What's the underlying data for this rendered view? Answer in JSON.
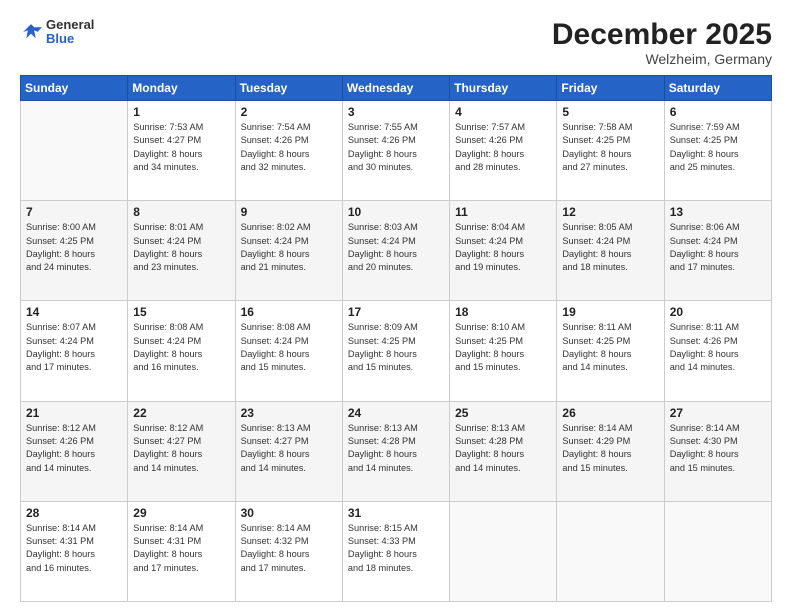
{
  "header": {
    "logo_general": "General",
    "logo_blue": "Blue",
    "month": "December 2025",
    "location": "Welzheim, Germany"
  },
  "weekdays": [
    "Sunday",
    "Monday",
    "Tuesday",
    "Wednesday",
    "Thursday",
    "Friday",
    "Saturday"
  ],
  "weeks": [
    [
      {
        "day": "",
        "info": ""
      },
      {
        "day": "1",
        "info": "Sunrise: 7:53 AM\nSunset: 4:27 PM\nDaylight: 8 hours\nand 34 minutes."
      },
      {
        "day": "2",
        "info": "Sunrise: 7:54 AM\nSunset: 4:26 PM\nDaylight: 8 hours\nand 32 minutes."
      },
      {
        "day": "3",
        "info": "Sunrise: 7:55 AM\nSunset: 4:26 PM\nDaylight: 8 hours\nand 30 minutes."
      },
      {
        "day": "4",
        "info": "Sunrise: 7:57 AM\nSunset: 4:26 PM\nDaylight: 8 hours\nand 28 minutes."
      },
      {
        "day": "5",
        "info": "Sunrise: 7:58 AM\nSunset: 4:25 PM\nDaylight: 8 hours\nand 27 minutes."
      },
      {
        "day": "6",
        "info": "Sunrise: 7:59 AM\nSunset: 4:25 PM\nDaylight: 8 hours\nand 25 minutes."
      }
    ],
    [
      {
        "day": "7",
        "info": "Sunrise: 8:00 AM\nSunset: 4:25 PM\nDaylight: 8 hours\nand 24 minutes."
      },
      {
        "day": "8",
        "info": "Sunrise: 8:01 AM\nSunset: 4:24 PM\nDaylight: 8 hours\nand 23 minutes."
      },
      {
        "day": "9",
        "info": "Sunrise: 8:02 AM\nSunset: 4:24 PM\nDaylight: 8 hours\nand 21 minutes."
      },
      {
        "day": "10",
        "info": "Sunrise: 8:03 AM\nSunset: 4:24 PM\nDaylight: 8 hours\nand 20 minutes."
      },
      {
        "day": "11",
        "info": "Sunrise: 8:04 AM\nSunset: 4:24 PM\nDaylight: 8 hours\nand 19 minutes."
      },
      {
        "day": "12",
        "info": "Sunrise: 8:05 AM\nSunset: 4:24 PM\nDaylight: 8 hours\nand 18 minutes."
      },
      {
        "day": "13",
        "info": "Sunrise: 8:06 AM\nSunset: 4:24 PM\nDaylight: 8 hours\nand 17 minutes."
      }
    ],
    [
      {
        "day": "14",
        "info": "Sunrise: 8:07 AM\nSunset: 4:24 PM\nDaylight: 8 hours\nand 17 minutes."
      },
      {
        "day": "15",
        "info": "Sunrise: 8:08 AM\nSunset: 4:24 PM\nDaylight: 8 hours\nand 16 minutes."
      },
      {
        "day": "16",
        "info": "Sunrise: 8:08 AM\nSunset: 4:24 PM\nDaylight: 8 hours\nand 15 minutes."
      },
      {
        "day": "17",
        "info": "Sunrise: 8:09 AM\nSunset: 4:25 PM\nDaylight: 8 hours\nand 15 minutes."
      },
      {
        "day": "18",
        "info": "Sunrise: 8:10 AM\nSunset: 4:25 PM\nDaylight: 8 hours\nand 15 minutes."
      },
      {
        "day": "19",
        "info": "Sunrise: 8:11 AM\nSunset: 4:25 PM\nDaylight: 8 hours\nand 14 minutes."
      },
      {
        "day": "20",
        "info": "Sunrise: 8:11 AM\nSunset: 4:26 PM\nDaylight: 8 hours\nand 14 minutes."
      }
    ],
    [
      {
        "day": "21",
        "info": "Sunrise: 8:12 AM\nSunset: 4:26 PM\nDaylight: 8 hours\nand 14 minutes."
      },
      {
        "day": "22",
        "info": "Sunrise: 8:12 AM\nSunset: 4:27 PM\nDaylight: 8 hours\nand 14 minutes."
      },
      {
        "day": "23",
        "info": "Sunrise: 8:13 AM\nSunset: 4:27 PM\nDaylight: 8 hours\nand 14 minutes."
      },
      {
        "day": "24",
        "info": "Sunrise: 8:13 AM\nSunset: 4:28 PM\nDaylight: 8 hours\nand 14 minutes."
      },
      {
        "day": "25",
        "info": "Sunrise: 8:13 AM\nSunset: 4:28 PM\nDaylight: 8 hours\nand 14 minutes."
      },
      {
        "day": "26",
        "info": "Sunrise: 8:14 AM\nSunset: 4:29 PM\nDaylight: 8 hours\nand 15 minutes."
      },
      {
        "day": "27",
        "info": "Sunrise: 8:14 AM\nSunset: 4:30 PM\nDaylight: 8 hours\nand 15 minutes."
      }
    ],
    [
      {
        "day": "28",
        "info": "Sunrise: 8:14 AM\nSunset: 4:31 PM\nDaylight: 8 hours\nand 16 minutes."
      },
      {
        "day": "29",
        "info": "Sunrise: 8:14 AM\nSunset: 4:31 PM\nDaylight: 8 hours\nand 17 minutes."
      },
      {
        "day": "30",
        "info": "Sunrise: 8:14 AM\nSunset: 4:32 PM\nDaylight: 8 hours\nand 17 minutes."
      },
      {
        "day": "31",
        "info": "Sunrise: 8:15 AM\nSunset: 4:33 PM\nDaylight: 8 hours\nand 18 minutes."
      },
      {
        "day": "",
        "info": ""
      },
      {
        "day": "",
        "info": ""
      },
      {
        "day": "",
        "info": ""
      }
    ]
  ]
}
